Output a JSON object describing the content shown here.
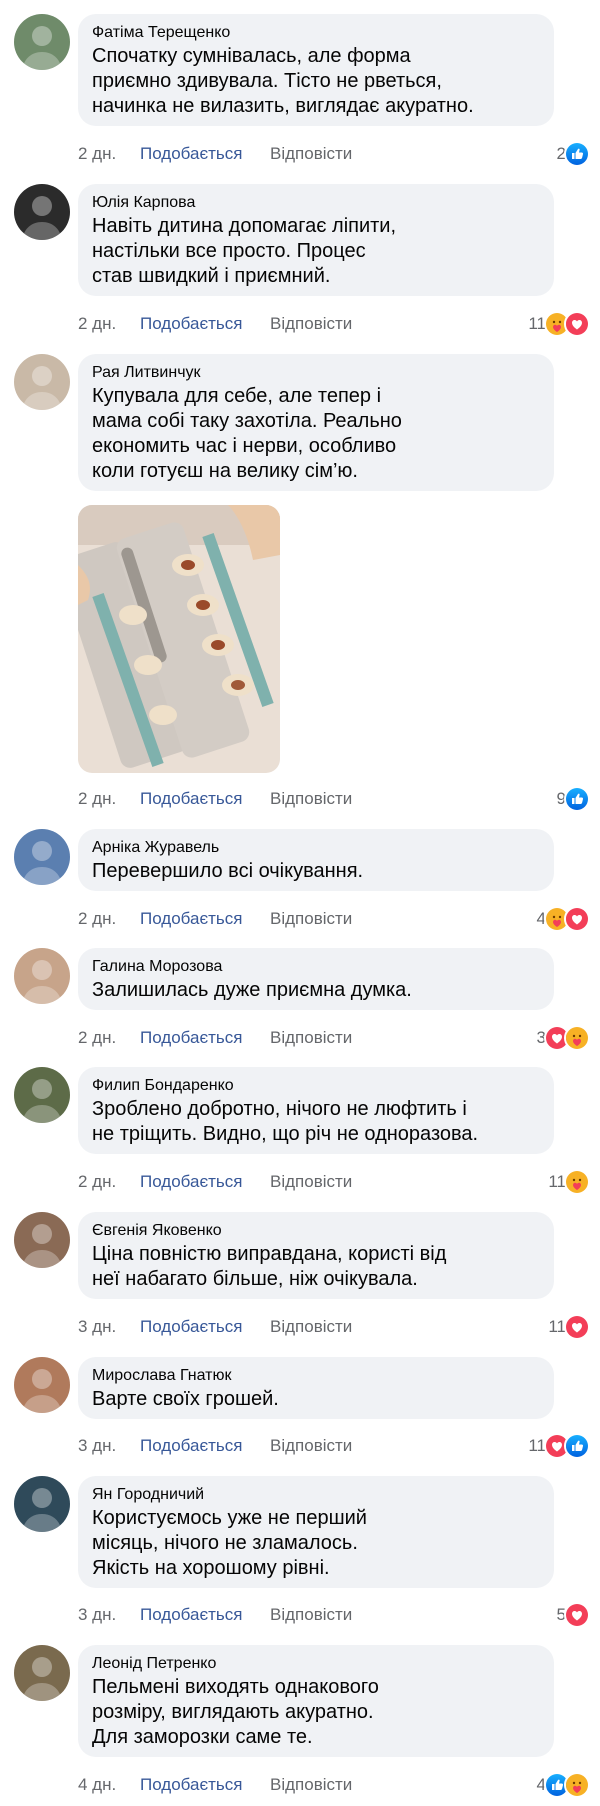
{
  "ui": {
    "like_label": "Подобається",
    "reply_label": "Відповісти"
  },
  "colors": {
    "bubble": "#f0f2f5",
    "link_blue": "#385898",
    "meta_gray": "#65676b",
    "like_blue": "#1877f2",
    "love_red": "#f33e58",
    "care_yellow": "#f7b125"
  },
  "comments": [
    {
      "name": "Фатіма Терещенко",
      "text": "Спочатку сумнівалась, але форма\nприємно здивувала. Тісто не рветься,\nначинка не вилазить, виглядає акуратно.",
      "time": "2 дн.",
      "reaction_count": "2",
      "reactions": [
        "like-icon"
      ],
      "avatar_color": "#6f8b6a"
    },
    {
      "name": "Юлія Карпова",
      "text": "Навіть дитина допомагає ліпити,\nнастільки все просто. Процес\nстав швидкий і приємний.",
      "time": "2 дн.",
      "reaction_count": "11",
      "reactions": [
        "care-icon",
        "love-icon"
      ],
      "avatar_color": "#2b2b2b"
    },
    {
      "name": "Рая Литвинчук",
      "text": "Купувала для себе, але тепер і\nмама собі таку захотіла. Реально\nекономить час і нерви, особливо\nколи готуєш на велику сім’ю.",
      "time": "2 дн.",
      "reaction_count": "9",
      "reactions": [
        "like-icon"
      ],
      "avatar_color": "#c9b9a7"
    },
    {
      "name": "Арніка Журавель",
      "text": "Перевершило всі очікування.",
      "time": "2 дн.",
      "reaction_count": "4",
      "reactions": [
        "care-icon",
        "love-icon"
      ],
      "avatar_color": "#5b7fb0"
    },
    {
      "name": "Галина Морозова",
      "text": "Залишилась дуже приємна думка.",
      "time": "2 дн.",
      "reaction_count": "3",
      "reactions": [
        "love-icon",
        "care-icon"
      ],
      "avatar_color": "#c7a48a"
    },
    {
      "name": "Филип Бондаренко",
      "text": "Зроблено добротно, нічого не люфтить і\nне тріщить. Видно, що річ не одноразова.",
      "time": "2 дн.",
      "reaction_count": "11",
      "reactions": [
        "care-icon"
      ],
      "avatar_color": "#5d6b48"
    },
    {
      "name": "Євгенія Яковенко",
      "text": "Ціна повністю виправдана, користі від\nнеї набагато більше, ніж очікувала.",
      "time": "3 дн.",
      "reaction_count": "11",
      "reactions": [
        "love-icon"
      ],
      "avatar_color": "#8a6a55"
    },
    {
      "name": "Мирослава Гнатюк",
      "text": "Варте своїх грошей.",
      "time": "3 дн.",
      "reaction_count": "11",
      "reactions": [
        "love-icon",
        "like-icon"
      ],
      "avatar_color": "#b07a5c"
    },
    {
      "name": "Ян Городничий",
      "text": "Користуємось уже не перший\nмісяць, нічого не зламалось.\nЯкість на хорошому рівні.",
      "time": "3 дн.",
      "reaction_count": "5",
      "reactions": [
        "love-icon"
      ],
      "avatar_color": "#2f4a5a"
    },
    {
      "name": "Леонід Петренко",
      "text": "Пельмені виходять однакового\nрозміру, виглядають акуратно.\nДля заморозки саме те.",
      "time": "4 дн.",
      "reaction_count": "4",
      "reactions": [
        "like-icon",
        "care-icon"
      ],
      "avatar_color": "#7a6a4e"
    }
  ]
}
